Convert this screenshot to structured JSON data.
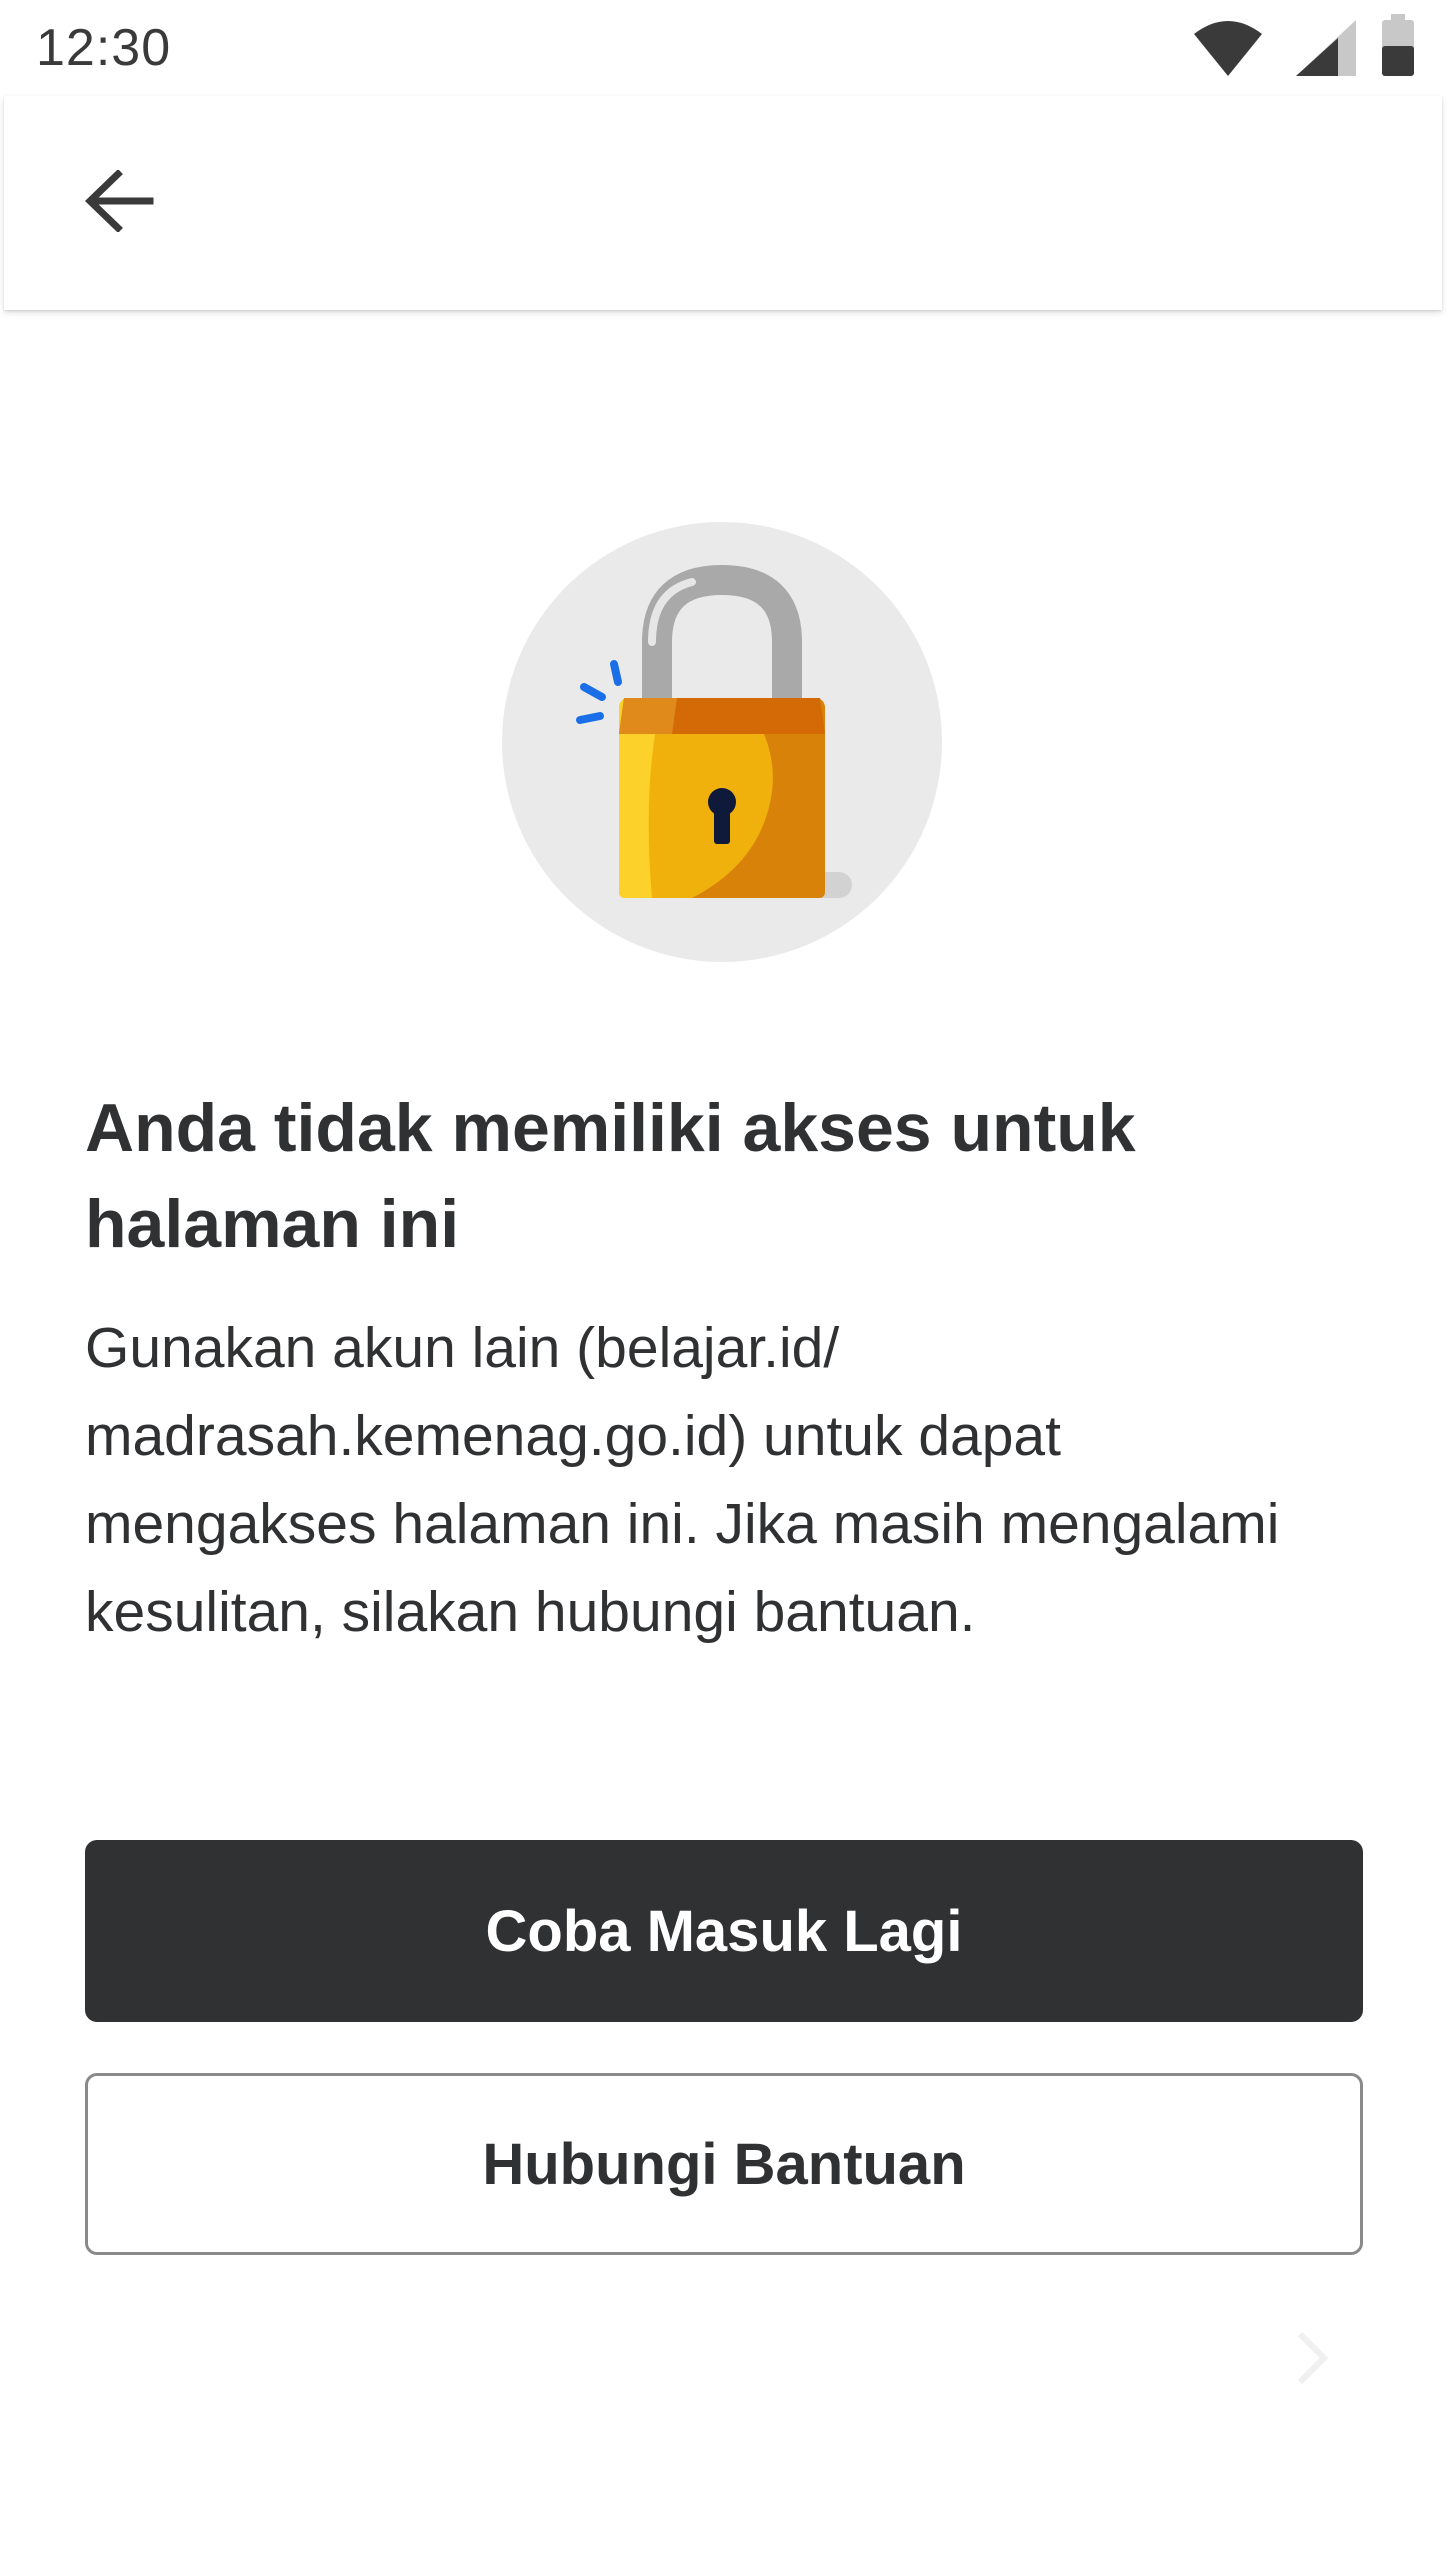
{
  "status_bar": {
    "time": "12:30",
    "icons": [
      "wifi-icon",
      "cellular-signal-icon",
      "battery-icon"
    ]
  },
  "app_bar": {
    "back_icon": "arrow-left-icon"
  },
  "illustration": {
    "icon": "padlock-icon"
  },
  "content": {
    "title": "Anda tidak memiliki akses untuk halaman ini",
    "message": "Gunakan akun lain (belajar.id/ madrasah.kemenag.go.id) untuk dapat mengakses halaman ini. Jika masih mengalami kesulitan, silakan hubungi bantuan."
  },
  "actions": {
    "retry_label": "Coba Masuk Lagi",
    "help_label": "Hubungi Bantuan"
  },
  "colors": {
    "primary_button": "#303133",
    "text": "#2f3133",
    "lock_body": "#f0b10c",
    "lock_shade": "#d9820a",
    "shackle": "#a9a9a9",
    "sparkle": "#1a6ee8",
    "circle_bg": "#eaeaea"
  }
}
